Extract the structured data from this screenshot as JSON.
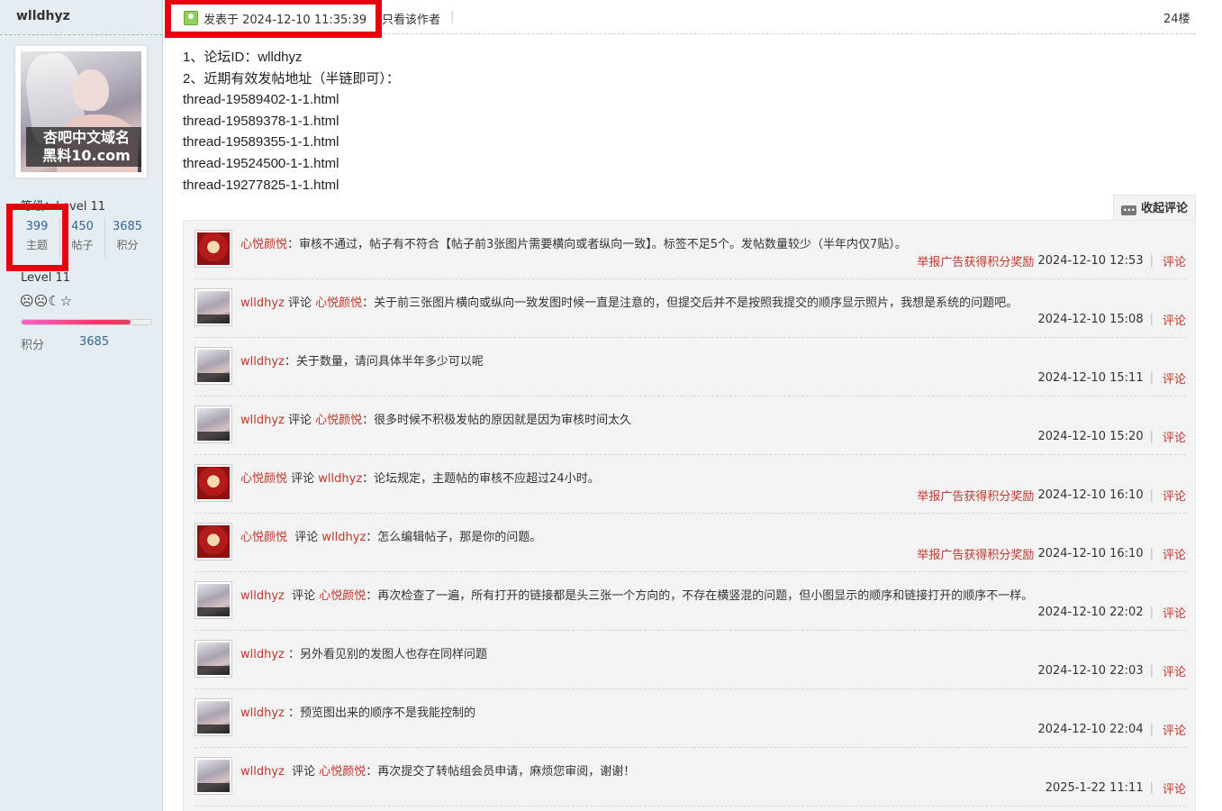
{
  "sidebar": {
    "username": "wlldhyz",
    "avatar_caption_1": "杏吧中文域名",
    "avatar_caption_2": "黑料10.com",
    "level_top": "等级：Level 11",
    "stats": [
      {
        "num": "399",
        "label": "主题"
      },
      {
        "num": "450",
        "label": "帖子"
      },
      {
        "num": "3685",
        "label": "积分"
      }
    ],
    "level": "Level 11",
    "emojis": "☹☹☾☆",
    "progress_fraction": 0.84,
    "points_label": "积分",
    "points_value": "3685"
  },
  "post": {
    "date": "发表于 2024-12-10 11:35:39",
    "only_author": "只看该作者",
    "separator": "|",
    "floor": "24楼",
    "lines": [
      "1、论坛ID：wlldhyz",
      "2、近期有效发帖地址（半链即可）：",
      "thread-19589402-1-1.html",
      "thread-19589378-1-1.html",
      "thread-19589355-1-1.html",
      "thread-19524500-1-1.html",
      "thread-19277825-1-1.html"
    ]
  },
  "comments_panel": {
    "collapse_label": "收起评论",
    "items": [
      {
        "avatar": "xin",
        "author": "心悦颜悦",
        "verb": "",
        "target": "",
        "text": "：审核不通过，帖子有不符合【帖子前3张图片需要横向或者纵向一致】。标签不足5个。发帖数量较少（半年内仅7贴）。",
        "report": "举报广告获得积分奖励",
        "time": "2024-12-10 12:53",
        "reply": "评论"
      },
      {
        "avatar": "wl",
        "author": "wlldhyz",
        "verb": " 评论 ",
        "target": "心悦颜悦",
        "text": "：关于前三张图片横向或纵向一致发图时候一直是注意的，但提交后并不是按照我提交的顺序显示照片，我想是系统的问题吧。",
        "report": "",
        "time": "2024-12-10 15:08",
        "reply": "评论"
      },
      {
        "avatar": "wl",
        "author": "wlldhyz",
        "verb": "",
        "target": "",
        "text": "：关于数量，请问具体半年多少可以呢",
        "report": "",
        "time": "2024-12-10 15:11",
        "reply": "评论"
      },
      {
        "avatar": "wl",
        "author": "wlldhyz",
        "verb": " 评论 ",
        "target": "心悦颜悦",
        "text": "：很多时候不积极发帖的原因就是因为审核时间太久",
        "report": "",
        "time": "2024-12-10 15:20",
        "reply": "评论"
      },
      {
        "avatar": "xin",
        "author": "心悦颜悦",
        "verb": " 评论 ",
        "target": "wlldhyz",
        "text": "：论坛规定，主题帖的审核不应超过24小时。",
        "report": "举报广告获得积分奖励",
        "time": "2024-12-10 16:10",
        "reply": "评论"
      },
      {
        "avatar": "xin",
        "author": "心悦颜悦",
        "verb": "  评论 ",
        "target": "wlldhyz",
        "text": "：怎么编辑帖子，那是你的问题。",
        "report": "举报广告获得积分奖励",
        "time": "2024-12-10 16:10",
        "reply": "评论"
      },
      {
        "avatar": "wl",
        "author": "wlldhyz",
        "verb": "  评论 ",
        "target": "心悦颜悦",
        "text": "：再次检查了一遍，所有打开的链接都是头三张一个方向的，不存在横竖混的问题，但小图显示的顺序和链接打开的顺序不一样。",
        "report": "",
        "time": "2024-12-10 22:02",
        "reply": "评论"
      },
      {
        "avatar": "wl",
        "author": "wlldhyz",
        "verb": " ",
        "target": "",
        "text": "：另外看见别的发图人也存在同样问题",
        "report": "",
        "time": "2024-12-10 22:03",
        "reply": "评论"
      },
      {
        "avatar": "wl",
        "author": "wlldhyz",
        "verb": " ",
        "target": "",
        "text": "：预览图出来的顺序不是我能控制的",
        "report": "",
        "time": "2024-12-10 22:04",
        "reply": "评论"
      },
      {
        "avatar": "wl",
        "author": "wlldhyz",
        "verb": "  评论 ",
        "target": "心悦颜悦",
        "text": "：再次提交了转帖组会员申请，麻烦您审阅，谢谢！",
        "report": "",
        "time": "2025-1-22 11:11",
        "reply": "评论"
      }
    ]
  },
  "colors": {
    "sidebar_bg": "#e5edf2",
    "link_red": "#c1372c",
    "stat_blue": "#336699",
    "highlight_red": "#e8000f"
  }
}
